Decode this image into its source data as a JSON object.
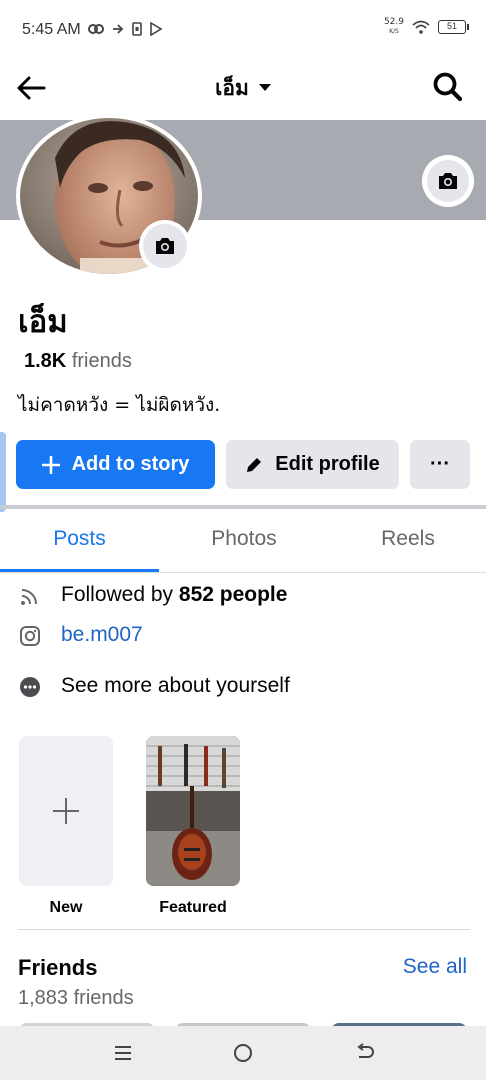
{
  "status_bar": {
    "time": "5:45 AM",
    "net_speed": "52.9",
    "net_unit": "K/S",
    "battery": "51"
  },
  "nav": {
    "title": "เอ็ม"
  },
  "profile": {
    "name": "เอ็ม",
    "friends_count": "1.8K",
    "friends_word": "friends",
    "bio": "ไม่คาดหวัง = ไม่ผิดหวัง."
  },
  "buttons": {
    "add_story": "Add to story",
    "edit_profile": "Edit profile",
    "more": "···"
  },
  "tabs": [
    {
      "label": "Posts",
      "active": true
    },
    {
      "label": "Photos",
      "active": false
    },
    {
      "label": "Reels",
      "active": false
    }
  ],
  "details": {
    "followed_prefix": "Followed by ",
    "followed_count": "852 people",
    "instagram": "be.m007",
    "see_more": "See more about yourself"
  },
  "featured": {
    "new_label": "New",
    "featured_label": "Featured"
  },
  "friends_section": {
    "title": "Friends",
    "see_all": "See all",
    "count_text": "1,883 friends"
  },
  "colors": {
    "accent": "#1877f2",
    "link": "#1f64c7",
    "secondary_text": "#65676b",
    "button_gray": "#e4e6eb",
    "cover": "#a7abb1"
  },
  "icons": {
    "back": "arrow-left-icon",
    "search": "search-icon",
    "camera": "camera-icon",
    "rss": "rss-icon",
    "instagram": "instagram-icon",
    "more": "more-dots-icon",
    "plus": "plus-icon",
    "pencil": "pencil-icon"
  }
}
